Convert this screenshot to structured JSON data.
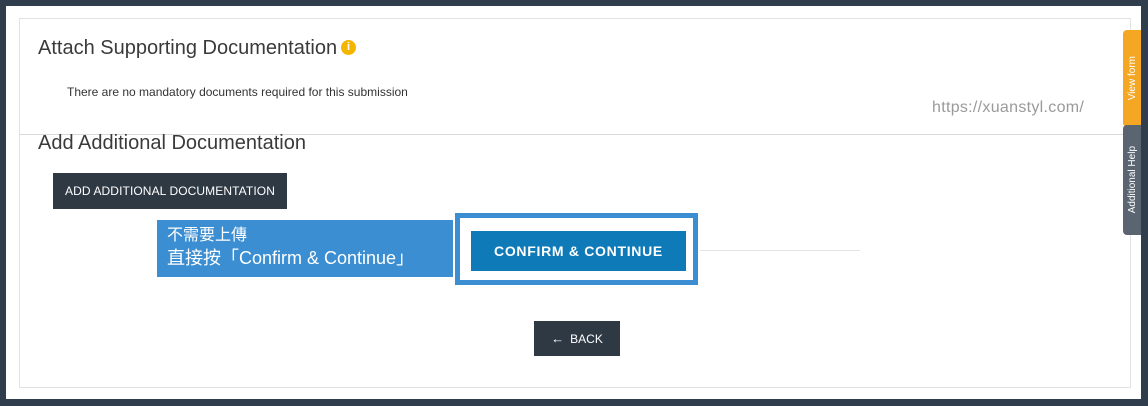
{
  "attach_section": {
    "title": "Attach Supporting Documentation",
    "info_icon": "i",
    "message": "There are no mandatory documents required for this submission"
  },
  "additional_section": {
    "title": "Add Additional Documentation",
    "add_button_label": "ADD ADDITIONAL DOCUMENTATION"
  },
  "callout": {
    "line1": "不需要上傳",
    "line2": "直接按「Confirm & Continue」"
  },
  "actions": {
    "confirm_label": "CONFIRM & CONTINUE",
    "back_arrow": "←",
    "back_label": "BACK"
  },
  "side_tabs": {
    "view_form": "View form",
    "additional_help": "Additional Help"
  },
  "watermark": "https://xuanstyl.com/",
  "colors": {
    "primary_button": "#0f7ab8",
    "dark_button": "#2e3944",
    "callout": "#3b8ed1",
    "info": "#f4b500",
    "view_form_tab": "#f5a623",
    "help_tab": "#5a6571"
  }
}
